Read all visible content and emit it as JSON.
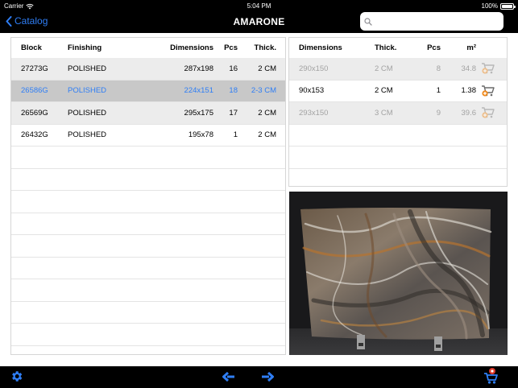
{
  "status": {
    "carrier": "Carrier",
    "time": "5:04 PM",
    "battery": "100%"
  },
  "nav": {
    "back_label": "Catalog",
    "title": "AMARONE",
    "search_placeholder": ""
  },
  "left_table": {
    "headers": {
      "block": "Block",
      "finishing": "Finishing",
      "dimensions": "Dimensions",
      "pcs": "Pcs",
      "thick": "Thick."
    },
    "rows": [
      {
        "block": "27273G",
        "finishing": "POLISHED",
        "dimensions": "287x198",
        "pcs": "16",
        "thick": "2 CM"
      },
      {
        "block": "26586G",
        "finishing": "POLISHED",
        "dimensions": "224x151",
        "pcs": "18",
        "thick": "2-3 CM"
      },
      {
        "block": "26569G",
        "finishing": "POLISHED",
        "dimensions": "295x175",
        "pcs": "17",
        "thick": "2 CM"
      },
      {
        "block": "26432G",
        "finishing": "POLISHED",
        "dimensions": "195x78",
        "pcs": "1",
        "thick": "2 CM"
      }
    ]
  },
  "right_table": {
    "headers": {
      "dimensions": "Dimensions",
      "thick": "Thick.",
      "pcs": "Pcs",
      "m2": "m²"
    },
    "rows": [
      {
        "dimensions": "290x150",
        "thick": "2 CM",
        "pcs": "8",
        "m2": "34.8"
      },
      {
        "dimensions": "90x153",
        "thick": "2 CM",
        "pcs": "1",
        "m2": "1.38"
      },
      {
        "dimensions": "293x150",
        "thick": "3 CM",
        "pcs": "9",
        "m2": "39.6"
      }
    ]
  },
  "colors": {
    "accent": "#2f7ef5",
    "cart_orange": "#f08a1c"
  }
}
